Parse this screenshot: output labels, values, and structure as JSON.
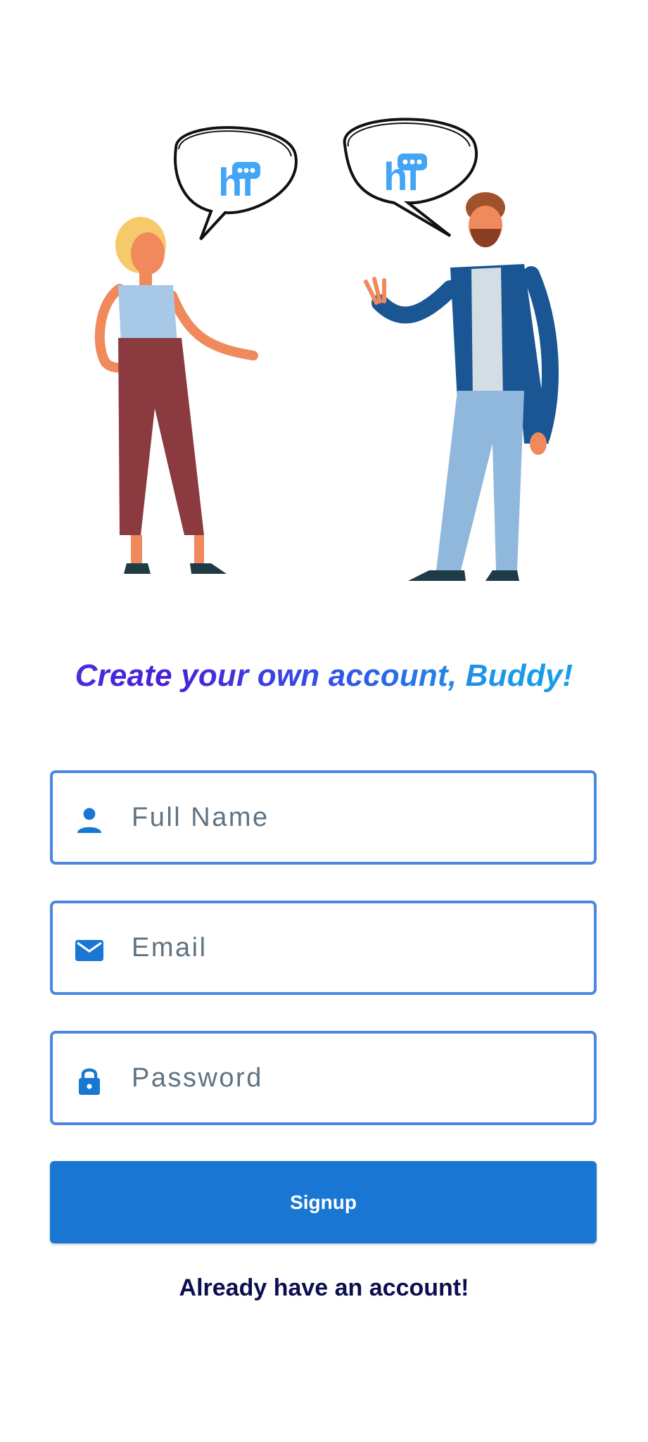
{
  "signup": {
    "headline": "Create your own account, Buddy!",
    "bubble_text": "hi",
    "fields": {
      "full_name": {
        "placeholder": "Full Name",
        "value": "",
        "icon": "person-icon"
      },
      "email": {
        "placeholder": "Email",
        "value": "",
        "icon": "envelope-icon"
      },
      "password": {
        "placeholder": "Password",
        "value": "",
        "icon": "lock-icon"
      }
    },
    "signup_label": "Signup",
    "login_link": "Already have an account!"
  },
  "colors": {
    "accent": "#1976d2",
    "field_border": "#4a88e0",
    "link_text": "#0b0f4f",
    "headline_gradient_start": "#3c3ee6",
    "headline_gradient_end": "#10a8e6"
  }
}
